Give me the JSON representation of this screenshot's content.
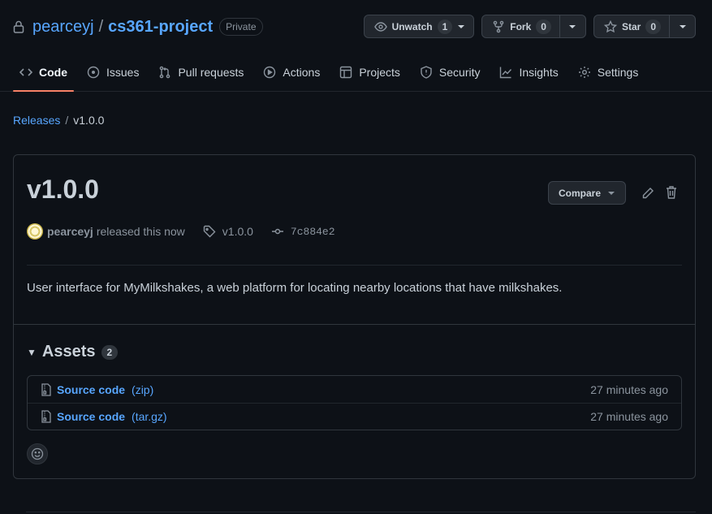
{
  "repo": {
    "owner": "pearceyj",
    "separator": "/",
    "name": "cs361-project",
    "visibility": "Private"
  },
  "actions": {
    "watch": {
      "label": "Unwatch",
      "count": "1"
    },
    "fork": {
      "label": "Fork",
      "count": "0"
    },
    "star": {
      "label": "Star",
      "count": "0"
    }
  },
  "tabs": [
    {
      "label": "Code",
      "icon": "code-icon",
      "active": true
    },
    {
      "label": "Issues",
      "icon": "issue-icon"
    },
    {
      "label": "Pull requests",
      "icon": "pull-request-icon"
    },
    {
      "label": "Actions",
      "icon": "play-icon"
    },
    {
      "label": "Projects",
      "icon": "table-icon"
    },
    {
      "label": "Security",
      "icon": "shield-icon"
    },
    {
      "label": "Insights",
      "icon": "graph-icon"
    },
    {
      "label": "Settings",
      "icon": "gear-icon"
    }
  ],
  "breadcrumb": {
    "parent": "Releases",
    "separator": "/",
    "current": "v1.0.0"
  },
  "release": {
    "title": "v1.0.0",
    "compare_label": "Compare",
    "author": "pearceyj",
    "released_text": "released this now",
    "tag": "v1.0.0",
    "commit": "7c884e2",
    "description": "User interface for MyMilkshakes, a web platform for locating nearby locations that have milkshakes."
  },
  "assets": {
    "title": "Assets",
    "count": "2",
    "items": [
      {
        "name": "Source code",
        "type": "(zip)",
        "time": "27 minutes ago"
      },
      {
        "name": "Source code",
        "type": "(tar.gz)",
        "time": "27 minutes ago"
      }
    ]
  },
  "colors": {
    "background": "#0d1117",
    "link": "#58a6ff",
    "tab_underline": "#f78166",
    "border": "#30363d"
  }
}
